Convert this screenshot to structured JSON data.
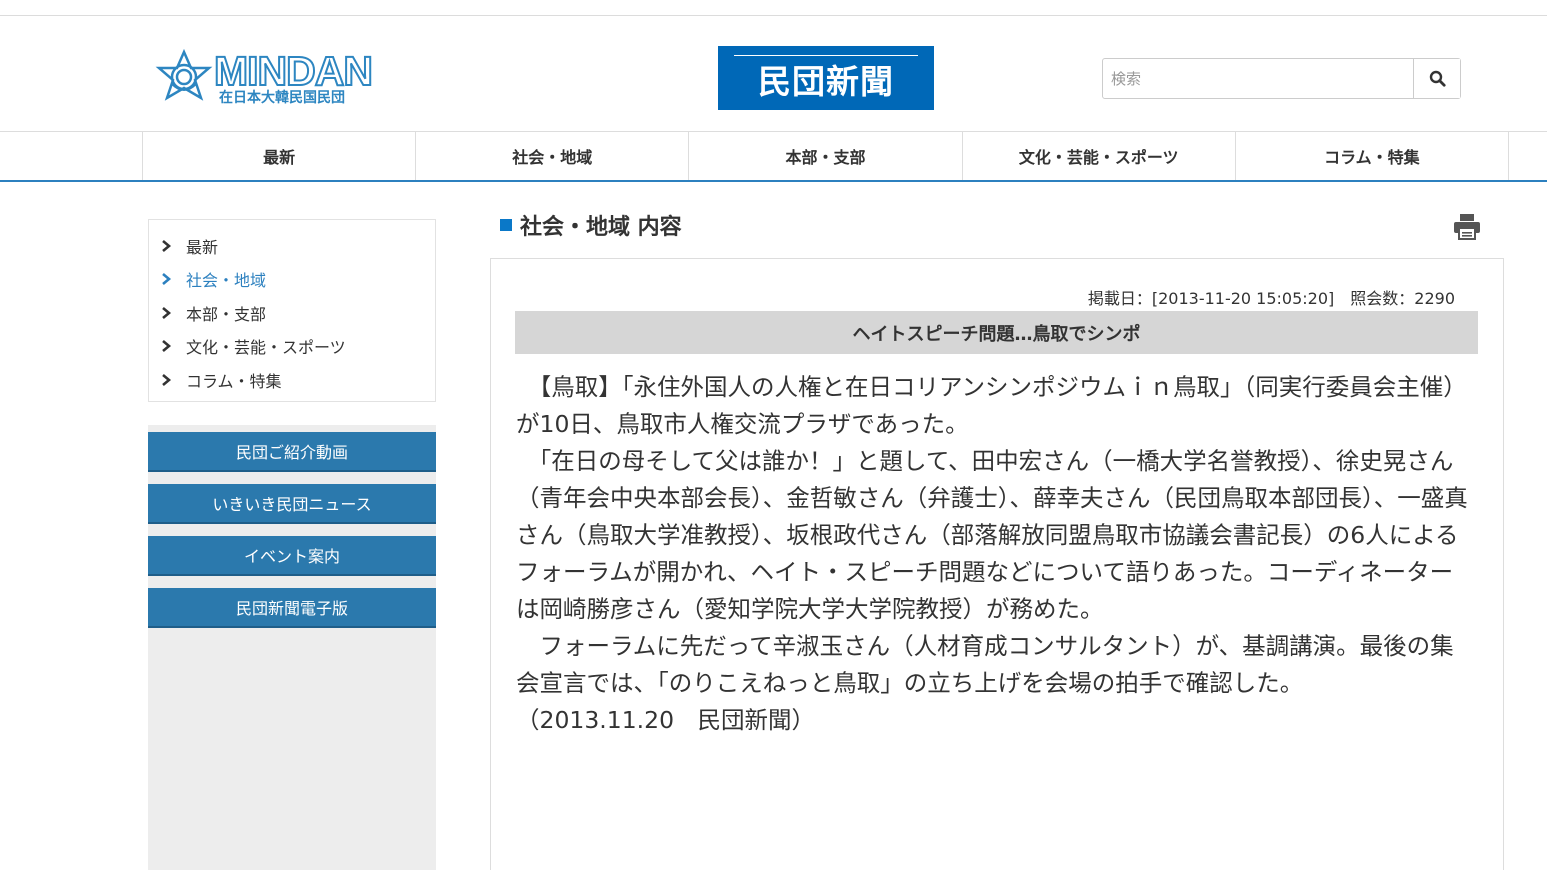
{
  "header": {
    "logo_text": "MINDAN",
    "logo_subtitle": "在日本大韓民国民団",
    "banner_title": "民団新聞",
    "search": {
      "placeholder": "検索",
      "value": "",
      "icon": "search-icon"
    }
  },
  "nav": {
    "items": [
      {
        "label": "最新"
      },
      {
        "label": "社会・地域"
      },
      {
        "label": "本部・支部"
      },
      {
        "label": "文化・芸能・スポーツ"
      },
      {
        "label": "コラム・特集"
      }
    ]
  },
  "sidebar": {
    "menu": [
      {
        "label": "最新"
      },
      {
        "label": "社会・地域",
        "active": true
      },
      {
        "label": "本部・支部"
      },
      {
        "label": "文化・芸能・スポーツ"
      },
      {
        "label": "コラム・特集"
      }
    ],
    "buttons": [
      {
        "label": "民団ご紹介動画"
      },
      {
        "label": "いきいき民団ニュース"
      },
      {
        "label": "イベント案内"
      },
      {
        "label": "民団新聞電子版"
      }
    ]
  },
  "main": {
    "section_title": "社会・地域 内容",
    "print_icon": "print-icon",
    "meta": "掲載日：[2013-11-20 15:05:20]　照会数：2290",
    "headline": "ヘイトスピーチ問題…鳥取でシンポ",
    "paragraphs": [
      "　【鳥取】「永住外国人の人権と在日コリアンシンポジウムｉｎ鳥取」（同実行委員会主催）が10日、鳥取市人権交流プラザであった。",
      "　「在日の母そして父は誰か！」と題して、田中宏さん（一橋大学名誉教授）、徐史晃さん（青年会中央本部会長）、金哲敏さん（弁護士）、薛幸夫さん（民団鳥取本部団長）、一盛真さん（鳥取大学准教授）、坂根政代さん（部落解放同盟鳥取市協議会書記長）の6人によるフォーラムが開かれ、ヘイト・スピーチ問題などについて語りあった。コーディネーターは岡崎勝彦さん（愛知学院大学大学院教授）が務めた。",
      "　フォーラムに先だって辛淑玉さん（人材育成コンサルタント）が、基調講演。最後の集会宣言では、「のりこえねっと鳥取」の立ち上げを会場の拍手で確認した。",
      "（2013.11.20　民団新聞）"
    ]
  },
  "colors": {
    "brand_blue": "#0068b7",
    "nav_accent": "#2c80bf",
    "sidebar_button": "#2b79ad",
    "headline_bg": "#d6d6d6"
  }
}
